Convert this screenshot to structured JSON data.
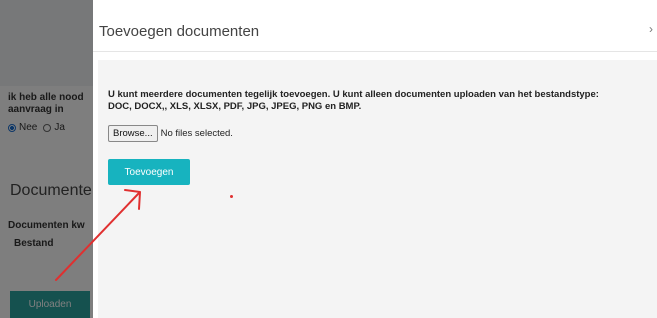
{
  "background": {
    "question_line1": "ik heb alle nood",
    "question_line2": "aanvraag in",
    "radio_no": "Nee",
    "radio_yes": "Ja",
    "section_heading": "Documente",
    "docs_label": "Documenten kw",
    "column_bestand": "Bestand",
    "upload_button": "Uploaden"
  },
  "modal": {
    "title": "Toevoegen documenten",
    "close_symbol": "›",
    "info_line1": "U kunt meerdere documenten tegelijk toevoegen. U kunt alleen documenten uploaden van het bestandstype:",
    "info_line2": "DOC, DOCX,, XLS, XLSX, PDF, JPG, JPEG, PNG en BMP.",
    "browse_label": "Browse...",
    "file_status": "No files selected.",
    "add_button": "Toevoegen"
  },
  "colors": {
    "accent": "#17b3bf",
    "annotation": "#e03030"
  },
  "icons": {
    "close": "chevron-right-icon"
  }
}
